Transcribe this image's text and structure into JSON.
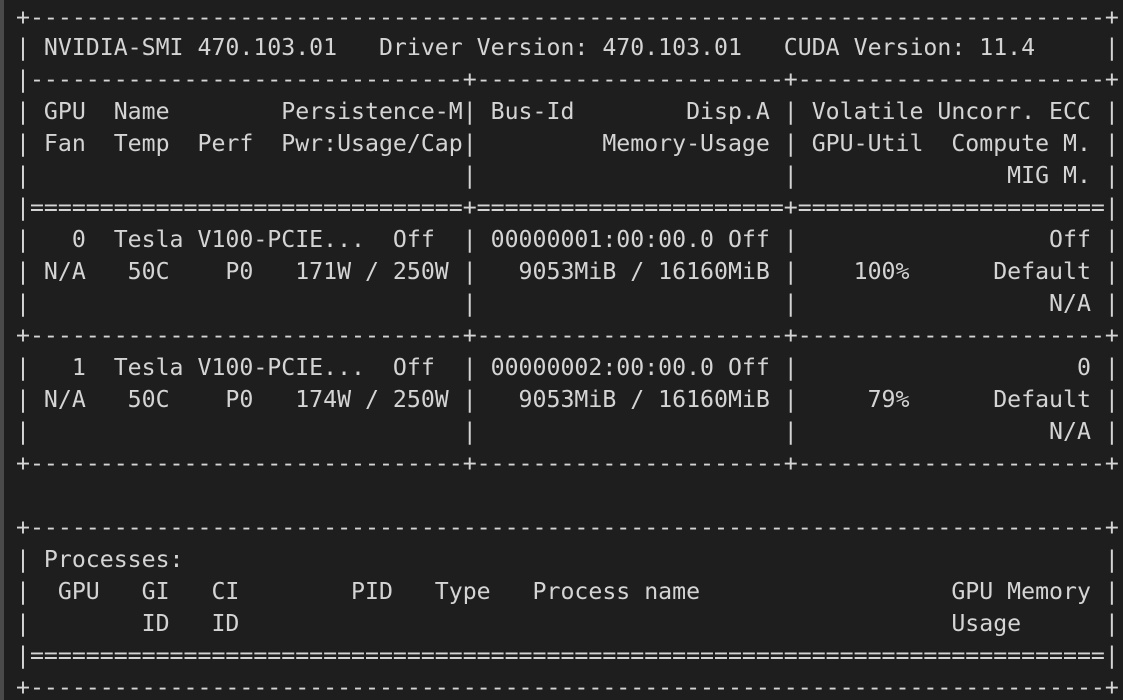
{
  "terminal": {
    "lines": [
      "+-----------------------------------------------------------------------------+",
      "| NVIDIA-SMI 470.103.01   Driver Version: 470.103.01   CUDA Version: 11.4     |",
      "|-------------------------------+----------------------+----------------------+",
      "| GPU  Name        Persistence-M| Bus-Id        Disp.A | Volatile Uncorr. ECC |",
      "| Fan  Temp  Perf  Pwr:Usage/Cap|         Memory-Usage | GPU-Util  Compute M. |",
      "|                               |                      |               MIG M. |",
      "|===============================+======================+======================|",
      "|   0  Tesla V100-PCIE...  Off  | 00000001:00:00.0 Off |                  Off |",
      "| N/A   50C    P0   171W / 250W |   9053MiB / 16160MiB |    100%      Default |",
      "|                               |                      |                  N/A |",
      "+-------------------------------+----------------------+----------------------+",
      "|   1  Tesla V100-PCIE...  Off  | 00000002:00:00.0 Off |                    0 |",
      "| N/A   50C    P0   174W / 250W |   9053MiB / 16160MiB |     79%      Default |",
      "|                               |                      |                  N/A |",
      "+-------------------------------+----------------------+----------------------+",
      "",
      "",
      "+-----------------------------------------------------------------------------+",
      "| Processes:                                                                  |",
      "|  GPU   GI   CI        PID   Type   Process name                  GPU Memory |",
      "|        ID   ID                                                   Usage      |",
      "|=============================================================================|",
      "+-----------------------------------------------------------------------------+"
    ]
  }
}
